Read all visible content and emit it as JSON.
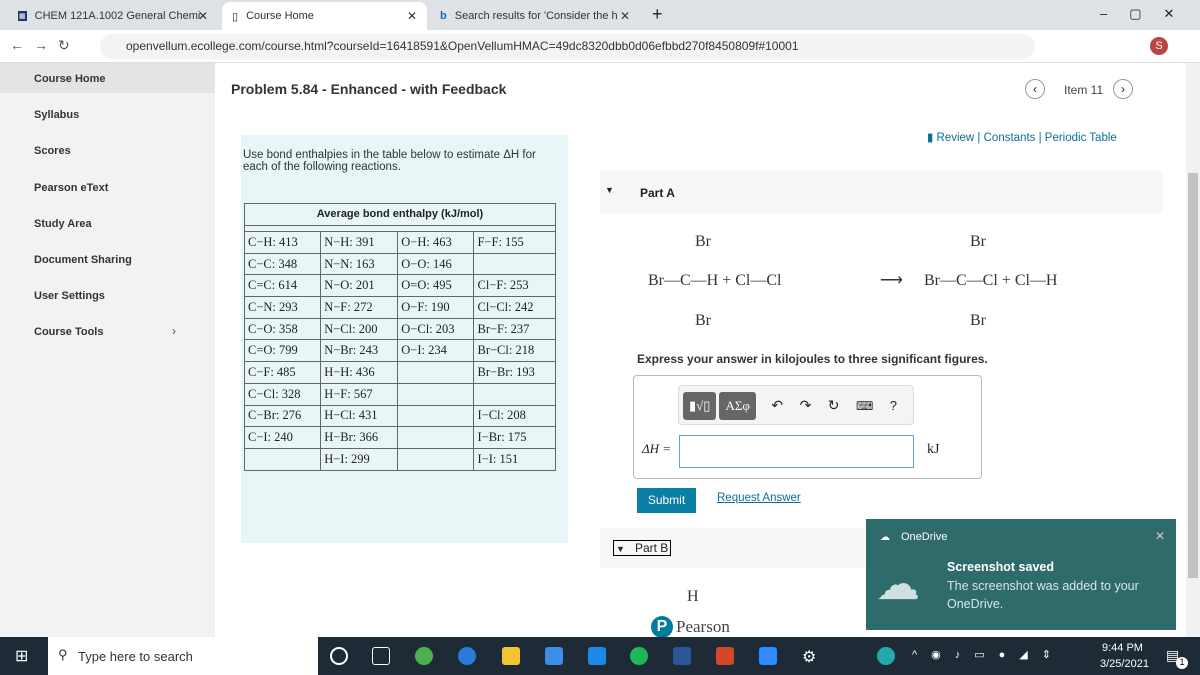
{
  "browser": {
    "tabs": [
      {
        "title": "CHEM 121A.1002 General Chemi"
      },
      {
        "title": "Course Home"
      },
      {
        "title": "Search results for 'Consider the h"
      }
    ],
    "url": "openvellum.ecollege.com/course.html?courseId=16418591&OpenVellumHMAC=49dc8320dbb0d06efbbd270f8450809f#10001",
    "profile": "S"
  },
  "sidebar": {
    "items": [
      {
        "label": "Course Home"
      },
      {
        "label": "Syllabus"
      },
      {
        "label": "Scores"
      },
      {
        "label": "Pearson eText"
      },
      {
        "label": "Study Area"
      },
      {
        "label": "Document Sharing"
      },
      {
        "label": "User Settings"
      },
      {
        "label": "Course Tools"
      }
    ]
  },
  "problem": {
    "title": "Problem 5.84 - Enhanced - with Feedback",
    "item": "Item 11",
    "links": "Review | Constants | Periodic Table",
    "intro": "Use bond enthalpies in the table below to estimate ΔH for each of the following reactions.",
    "table_title": "Average bond enthalpy (kJ/mol)",
    "table": [
      [
        "C−H: 413",
        "N−H: 391",
        "O−H: 463",
        "F−F: 155"
      ],
      [
        "C−C: 348",
        "N−N: 163",
        "O−O: 146",
        ""
      ],
      [
        "C=C: 614",
        "N−O: 201",
        "O=O: 495",
        "Cl−F: 253"
      ],
      [
        "C−N: 293",
        "N−F: 272",
        "O−F: 190",
        "Cl−Cl: 242"
      ],
      [
        "C−O: 358",
        "N−Cl: 200",
        "O−Cl: 203",
        "Br−F: 237"
      ],
      [
        "C=O: 799",
        "N−Br: 243",
        "O−I: 234",
        "Br−Cl: 218"
      ],
      [
        "C−F: 485",
        "H−H: 436",
        "",
        "Br−Br: 193"
      ],
      [
        "C−Cl: 328",
        "H−F: 567",
        "",
        ""
      ],
      [
        "C−Br: 276",
        "H−Cl: 431",
        "",
        "I−Cl: 208"
      ],
      [
        "C−I: 240",
        "H−Br: 366",
        "",
        "I−Br: 175"
      ],
      [
        "",
        "H−I: 299",
        "",
        "I−I: 151"
      ]
    ]
  },
  "partA": {
    "label": "Part A",
    "reaction": {
      "br_top1": "Br",
      "left": "Br—C—H + Cl—Cl",
      "arrow": "⟶",
      "right": "Br—C—Cl + Cl—H",
      "br_bot1": "Br",
      "br_top2": "Br",
      "br_bot2": "Br"
    },
    "instruction": "Express your answer in kilojoules to three significant figures.",
    "toolbar": {
      "templates": "▮√▯",
      "greek": "ΑΣφ",
      "help": "?"
    },
    "answer_label": "ΔH =",
    "answer_value": "",
    "unit": "kJ",
    "submit": "Submit",
    "request": "Request Answer"
  },
  "partB": {
    "label": "Part B",
    "fragment": "H"
  },
  "footer": {
    "brand": "Pearson"
  },
  "toast": {
    "app": "OneDrive",
    "title": "Screenshot saved",
    "body": "The screenshot was added to your OneDrive."
  },
  "taskbar": {
    "search_placeholder": "Type here to search",
    "time": "9:44 PM",
    "date": "3/25/2021",
    "notif_count": "1"
  },
  "colors": {
    "accent": "#007c9e",
    "toast": "#2f6b6b",
    "table_bg": "#e8f6f8"
  }
}
